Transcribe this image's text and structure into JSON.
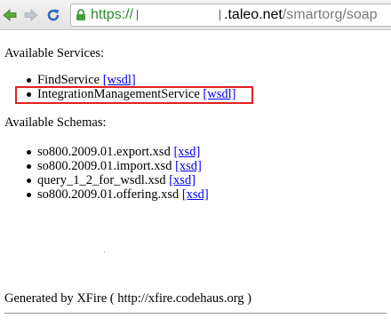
{
  "browser": {
    "url_protocol": "https://",
    "url_host_visible": ".taleo.net",
    "url_path": "/smartorg/soap",
    "icons": [
      "back-arrow-icon",
      "forward-arrow-icon",
      "reload-icon",
      "lock-icon"
    ]
  },
  "services": {
    "heading": "Available Services:",
    "items": [
      {
        "name": "FindService",
        "link": "[wsdl]"
      },
      {
        "name": "IntegrationManagementService",
        "link": "[wsdl]"
      }
    ]
  },
  "schemas": {
    "heading": "Available Schemas:",
    "items": [
      {
        "name": "so800.2009.01.export.xsd",
        "link": "[xsd]"
      },
      {
        "name": "so800.2009.01.import.xsd",
        "link": "[xsd]"
      },
      {
        "name": "query_1_2_for_wsdl.xsd",
        "link": "[xsd]"
      },
      {
        "name": "so800.2009.01.offering.xsd",
        "link": "[xsd]"
      }
    ]
  },
  "footer": {
    "text": "Generated by XFire ( http://xfire.codehaus.org )"
  },
  "colors": {
    "link": "#0000ee",
    "highlight": "#e02020",
    "secure_protocol": "#2e8b2e"
  }
}
